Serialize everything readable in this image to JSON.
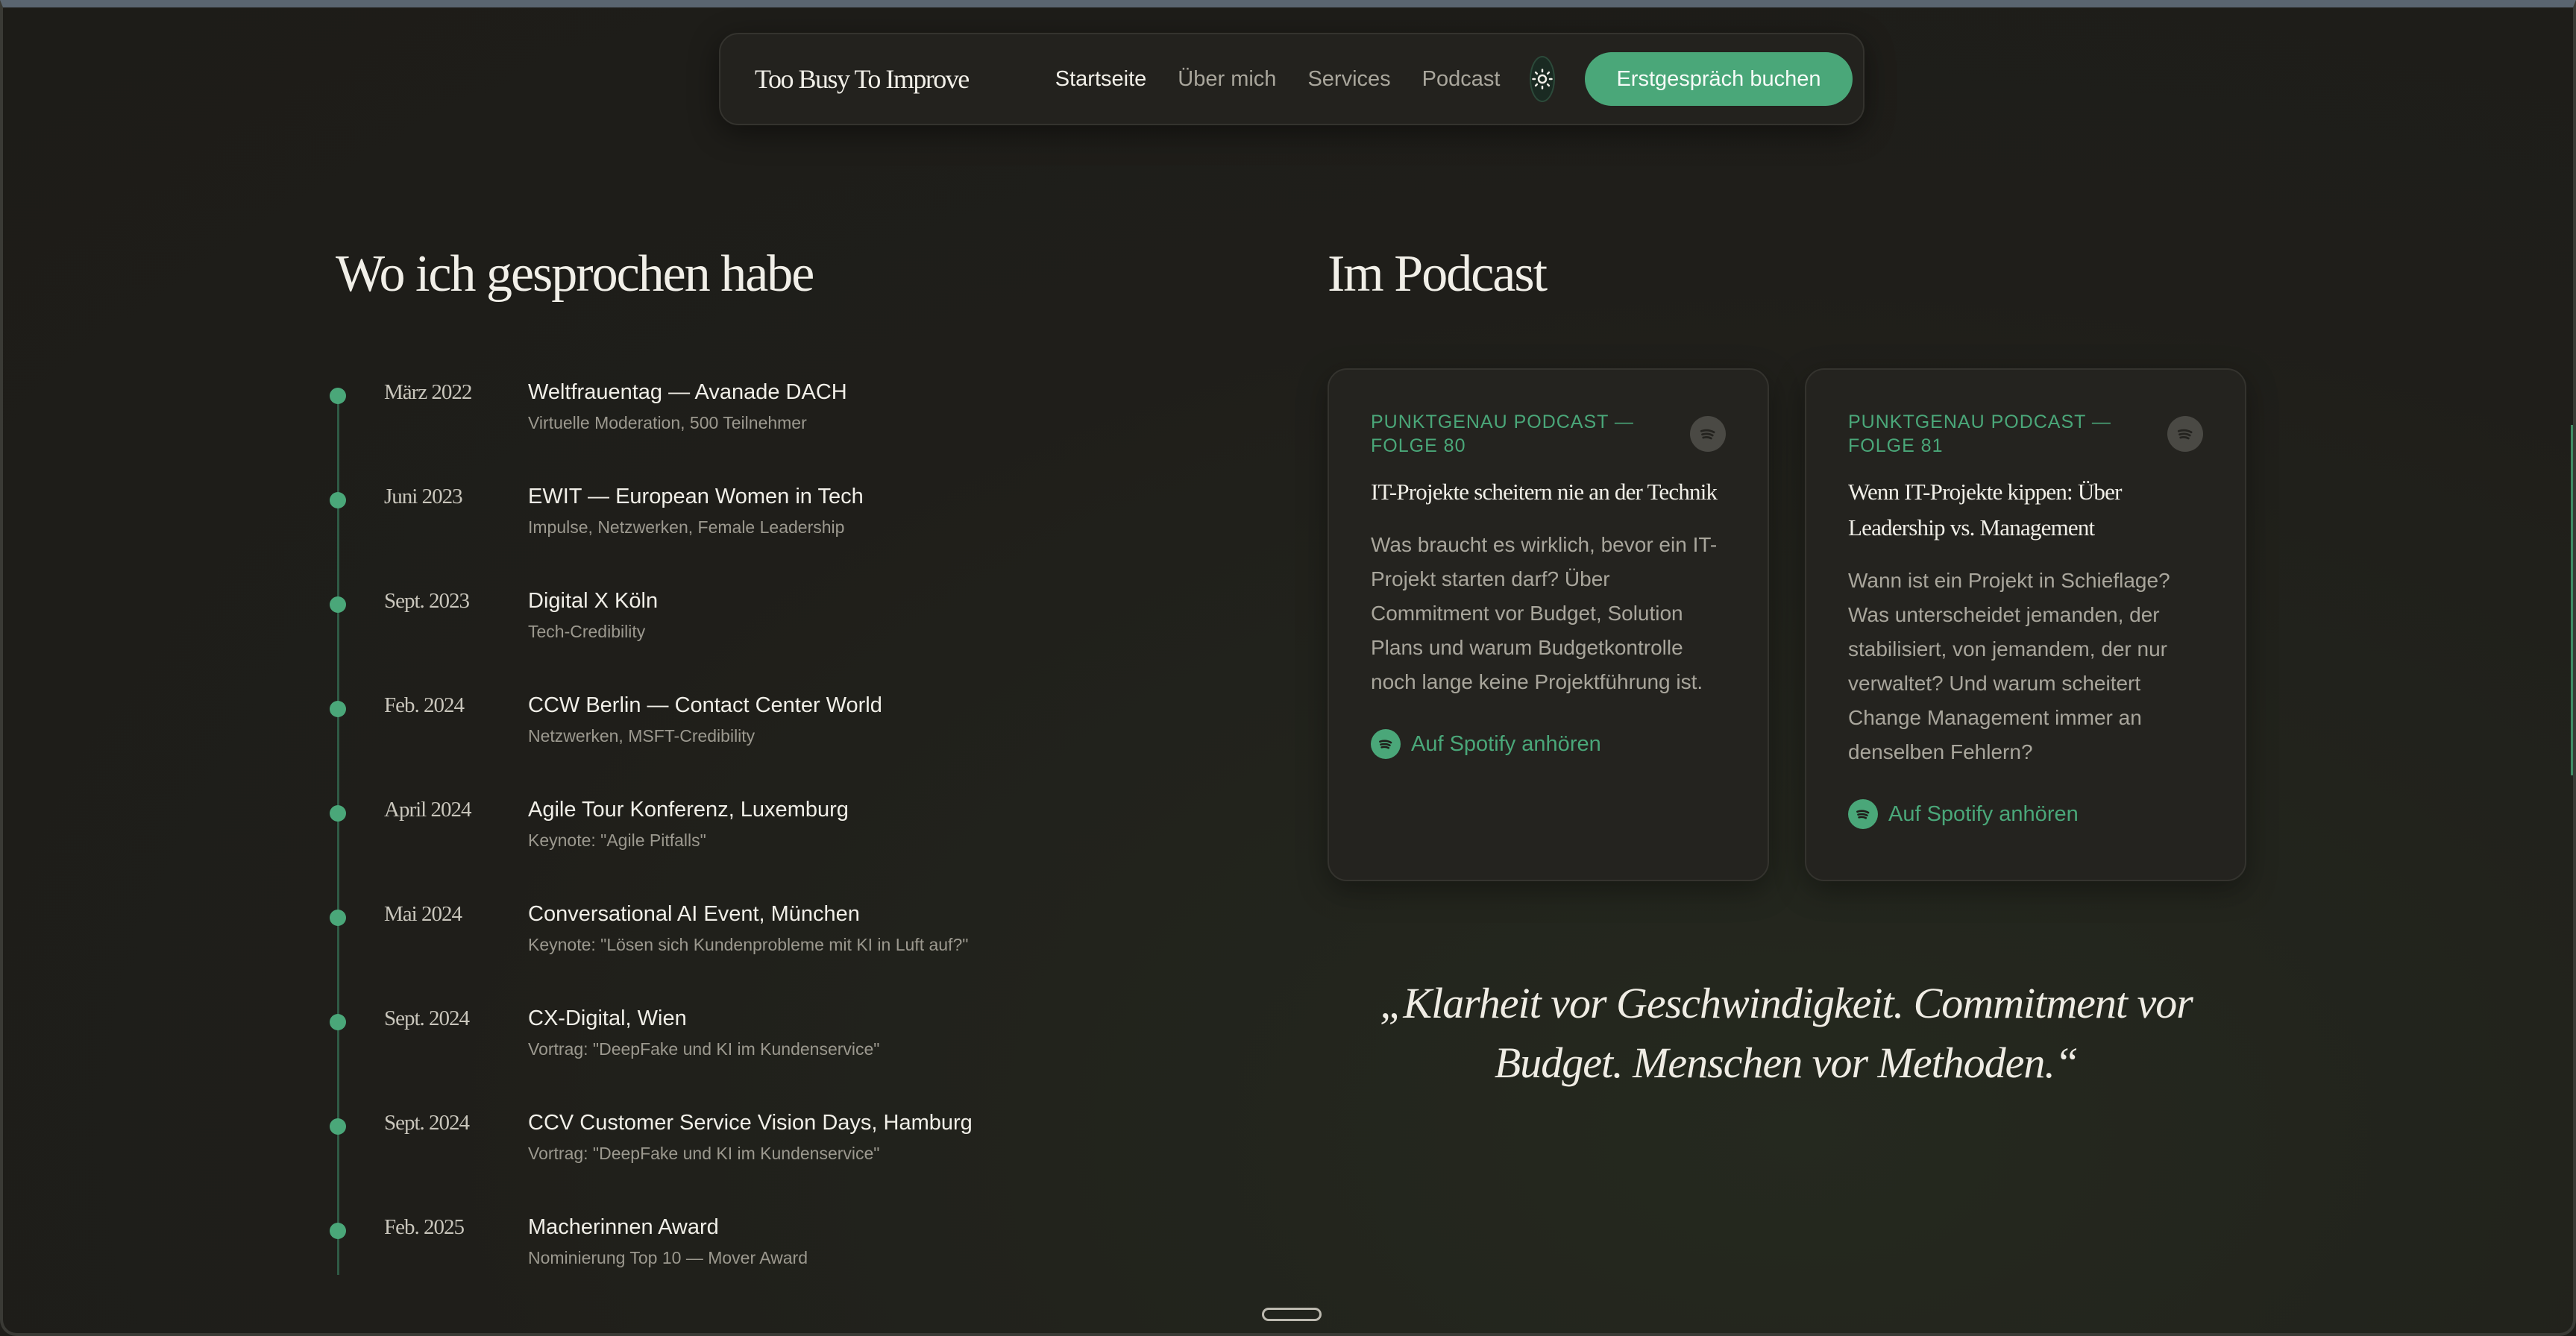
{
  "nav": {
    "brand": "Too Busy To Improve",
    "links": [
      "Startseite",
      "Über mich",
      "Services",
      "Podcast"
    ],
    "theme_icon": "sun-icon",
    "cta": "Erstgespräch buchen"
  },
  "talks": {
    "heading": "Wo ich gesprochen habe",
    "items": [
      {
        "date": "März 2022",
        "title": "Weltfrauentag — Avanade DACH",
        "sub": "Virtuelle Moderation, 500 Teilnehmer"
      },
      {
        "date": "Juni 2023",
        "title": "EWIT — European Women in Tech",
        "sub": "Impulse, Netzwerken, Female Leadership"
      },
      {
        "date": "Sept. 2023",
        "title": "Digital X Köln",
        "sub": "Tech-Credibility"
      },
      {
        "date": "Feb. 2024",
        "title": "CCW Berlin — Contact Center World",
        "sub": "Netzwerken, MSFT-Credibility"
      },
      {
        "date": "April 2024",
        "title": "Agile Tour Konferenz, Luxemburg",
        "sub": "Keynote: \"Agile Pitfalls\""
      },
      {
        "date": "Mai 2024",
        "title": "Conversational AI Event, München",
        "sub": "Keynote: \"Lösen sich Kundenprobleme mit KI in Luft auf?\""
      },
      {
        "date": "Sept. 2024",
        "title": "CX-Digital, Wien",
        "sub": "Vortrag: \"DeepFake und KI im Kundenservice\""
      },
      {
        "date": "Sept. 2024",
        "title": "CCV Customer Service Vision Days, Hamburg",
        "sub": "Vortrag: \"DeepFake und KI im Kundenservice\""
      },
      {
        "date": "Feb. 2025",
        "title": "Macherinnen Award",
        "sub": "Nominierung Top 10 — Mover Award"
      }
    ]
  },
  "podcast": {
    "heading": "Im Podcast",
    "cards": [
      {
        "label": "PUNKTGENAU PODCAST — FOLGE 80",
        "title": "IT-Projekte scheitern nie an der Technik",
        "desc": "Was braucht es wirklich, bevor ein IT-Projekt starten darf? Über Commitment vor Budget, Solution Plans und warum Budgetkontrolle noch lange keine Projektführung ist.",
        "link": "Auf Spotify anhören"
      },
      {
        "label": "PUNKTGENAU PODCAST — FOLGE 81",
        "title": "Wenn IT-Projekte kippen: Über Leadership vs. Management",
        "desc": "Wann ist ein Projekt in Schieflage? Was unterscheidet jemanden, der stabilisiert, von jemandem, der nur verwaltet? Und warum scheitert Change Management immer an denselben Fehlern?",
        "link": "Auf Spotify anhören"
      }
    ]
  },
  "quote": {
    "text": "„Klarheit vor Geschwindigkeit. Commitment vor Budget. Menschen vor Methoden.“"
  },
  "colors": {
    "accent": "#4aa779",
    "background": "#1f1e1a",
    "card": "#24231f"
  }
}
